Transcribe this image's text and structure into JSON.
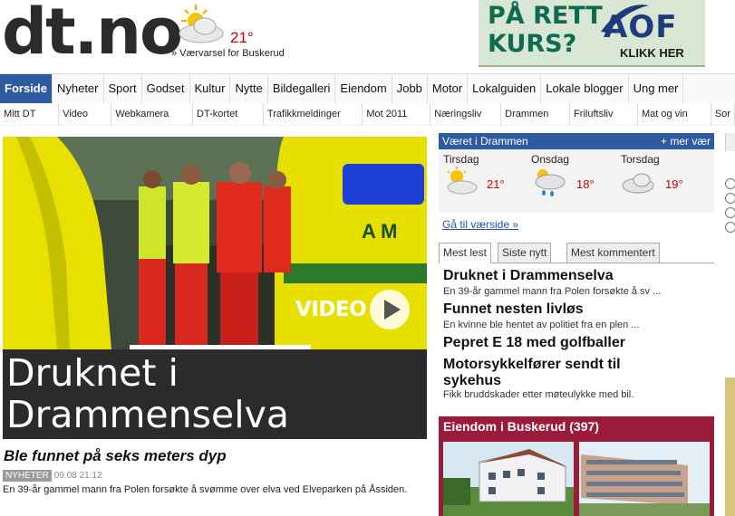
{
  "header": {
    "logo": "dt.no",
    "weather_temp": "21°",
    "weather_link": "» Værvarsel for Buskerud"
  },
  "ad": {
    "headline_1": "PÅ RETT",
    "headline_2": "KURS?",
    "brand": "AOF",
    "cta": "KLIKK HER"
  },
  "nav": {
    "items": [
      "Forside",
      "Nyheter",
      "Sport",
      "Godset",
      "Kultur",
      "Nytte",
      "Bildegalleri",
      "Eiendom",
      "Jobb",
      "Motor",
      "Lokalguiden",
      "Lokale blogger",
      "Ung mer"
    ]
  },
  "subnav": {
    "items": [
      "Mitt DT",
      "Video",
      "Webkamera",
      "DT-kortet",
      "Trafikkmeldinger",
      "Mot 2011",
      "Næringsliv",
      "Drammen",
      "Friluftsliv",
      "Mat og vin",
      "Sor"
    ]
  },
  "article": {
    "video_label": "VIDEO",
    "title": "Druknet i Drammenselva",
    "subhead": "Ble funnet på seks meters dyp",
    "tag": "NYHETER",
    "timestamp": "09.08 21:12",
    "lead": "En 39-år gammel mann fra Polen forsøkte å svømme over elva ved Elveparken på Åssiden."
  },
  "weather": {
    "title": "Været i Drammen",
    "more": "+ mer vær",
    "link": "Gå til værside »",
    "days": [
      {
        "name": "Tirsdag",
        "temp": "21°",
        "icon": "sun-cloud-icon"
      },
      {
        "name": "Onsdag",
        "temp": "18°",
        "icon": "rain-cloud-icon"
      },
      {
        "name": "Torsdag",
        "temp": "19°",
        "icon": "cloud-icon"
      }
    ]
  },
  "tabs": [
    "Mest lest",
    "Siste nytt",
    "Mest kommentert"
  ],
  "most_read": [
    {
      "title": "Druknet i Drammenselva",
      "summary": "En 39-år gammel mann fra Polen forsøkte å sv ..."
    },
    {
      "title": "Funnet nesten livløs",
      "summary": "En kvinne ble hentet av politiet fra en plen ..."
    },
    {
      "title": "Pepret E 18 med golfballer",
      "summary": ""
    },
    {
      "title": "Motorsykkelfører sendt til",
      "title2": "sykehus",
      "summary": "Fikk bruddskader etter møteulykke med bil."
    }
  ],
  "estate": {
    "title": "Eiendom i Buskerud (397)"
  },
  "colors": {
    "nav_active": "#2e5aa0",
    "temp_red": "#cc0000",
    "estate_bg": "#9b1b3b"
  }
}
